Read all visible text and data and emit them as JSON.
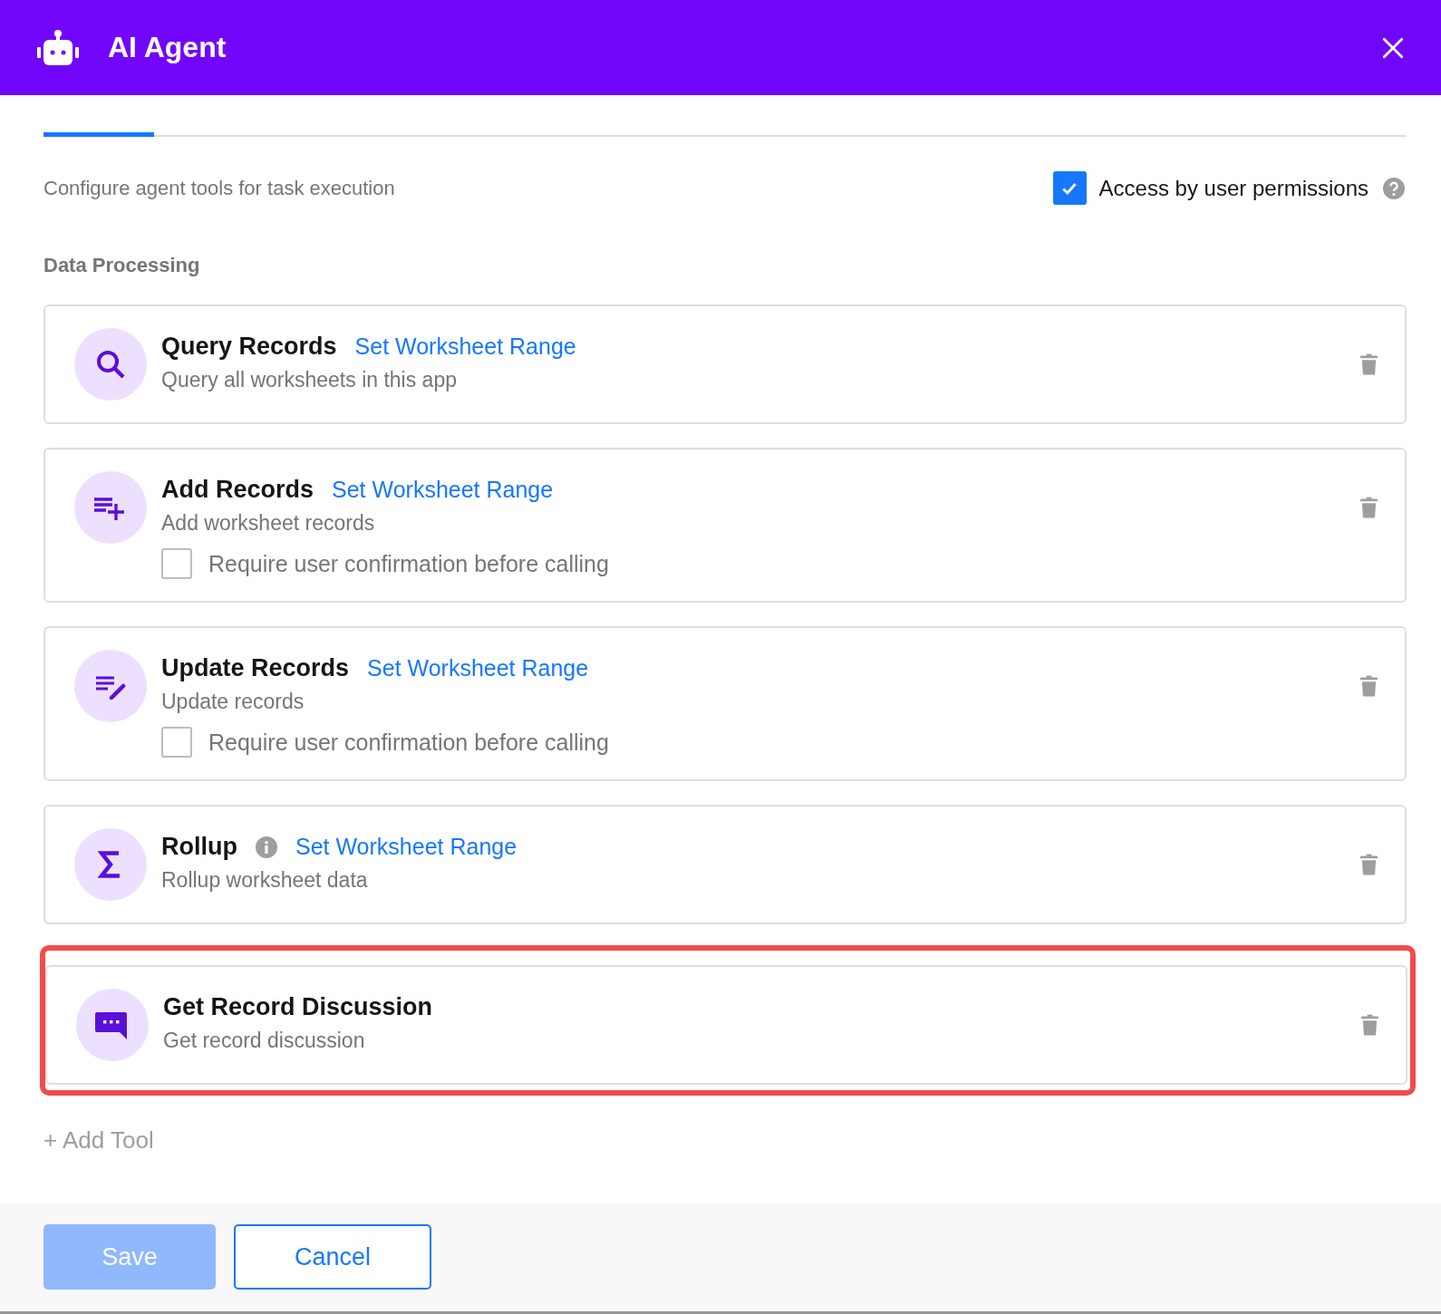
{
  "header": {
    "title": "AI Agent"
  },
  "intro": "Configure agent tools for task execution",
  "access": {
    "label": "Access by user permissions",
    "checked": true
  },
  "section": "Data Processing",
  "tools": [
    {
      "kind": "search",
      "name": "Query Records",
      "link": "Set Worksheet Range",
      "description": "Query all worksheets in this app"
    },
    {
      "kind": "add",
      "name": "Add Records",
      "link": "Set Worksheet Range",
      "description": "Add worksheet records",
      "confirm": {
        "label": "Require user confirmation before calling",
        "checked": false
      }
    },
    {
      "kind": "edit",
      "name": "Update Records",
      "link": "Set Worksheet Range",
      "description": "Update records",
      "confirm": {
        "label": "Require user confirmation before calling",
        "checked": false
      }
    },
    {
      "kind": "sum",
      "name": "Rollup",
      "info": true,
      "link": "Set Worksheet Range",
      "description": "Rollup worksheet data"
    },
    {
      "kind": "chat",
      "name": "Get Record Discussion",
      "description": "Get record discussion",
      "highlighted": true
    }
  ],
  "add_tool": "+ Add Tool",
  "buttons": {
    "save": {
      "label": "Save",
      "disabled": true
    },
    "cancel": {
      "label": "Cancel"
    }
  }
}
